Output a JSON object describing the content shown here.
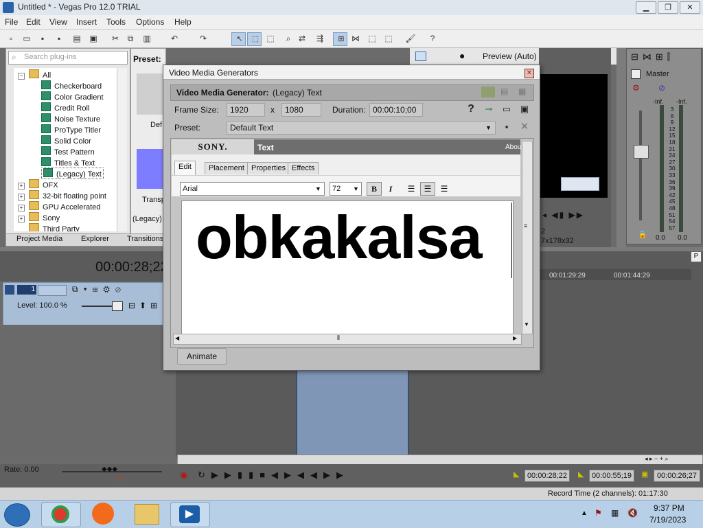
{
  "window": {
    "title": "Untitled * - Vegas Pro 12.0 TRIAL",
    "buttons": [
      "▁",
      "❐",
      "✕"
    ]
  },
  "menu": [
    "File",
    "Edit",
    "View",
    "Insert",
    "Tools",
    "Options",
    "Help"
  ],
  "plugins": {
    "search_placeholder": "Search plug-ins",
    "tree": [
      {
        "label": "All",
        "kind": "folder",
        "expander": "−"
      },
      {
        "label": "Checkerboard",
        "kind": "fx"
      },
      {
        "label": "Color Gradient",
        "kind": "fx"
      },
      {
        "label": "Credit Roll",
        "kind": "fx"
      },
      {
        "label": "Noise Texture",
        "kind": "fx"
      },
      {
        "label": "ProType Titler",
        "kind": "fx"
      },
      {
        "label": "Solid Color",
        "kind": "fx"
      },
      {
        "label": "Test Pattern",
        "kind": "fx"
      },
      {
        "label": "Titles & Text",
        "kind": "fx"
      },
      {
        "label": "(Legacy) Text",
        "kind": "fx",
        "selected": true
      },
      {
        "label": "OFX",
        "kind": "folder",
        "expander": "+"
      },
      {
        "label": "32-bit floating point",
        "kind": "folder",
        "expander": "+"
      },
      {
        "label": "GPU Accelerated",
        "kind": "folder",
        "expander": "+"
      },
      {
        "label": "Sony",
        "kind": "folder",
        "expander": "+"
      },
      {
        "label": "Third Party",
        "kind": "folder",
        "expander": ""
      }
    ],
    "preset_label": "Preset:",
    "preset_items": [
      "Def",
      "Transp",
      "(Legacy)"
    ]
  },
  "bottom_tabs": [
    "Project Media",
    "Explorer",
    "Transitions"
  ],
  "preview": {
    "label": "Preview (Auto)",
    "resolution": "7x178x32",
    "num": "2"
  },
  "master": {
    "title": "Master",
    "left_db": "-Inf.",
    "right_db": "-Inf.",
    "scale": [
      "3",
      "6",
      "9",
      "12",
      "15",
      "18",
      "21",
      "24",
      "27",
      "30",
      "33",
      "36",
      "39",
      "42",
      "45",
      "48",
      "51",
      "54",
      "57"
    ],
    "left_val": "0.0",
    "right_val": "0.0"
  },
  "timeline": {
    "timecode": "00:00:28;22",
    "track_number": "1",
    "level": "Level: 100.0 %",
    "ruler": [
      "00:01:29:29",
      "00:01:44:29"
    ],
    "rate": "Rate: 0.00",
    "time_a": "00:00:28;22",
    "time_b": "00:00:55;19",
    "time_c": "00:00:26;27",
    "record_time": "Record Time (2 channels): 01:17:30"
  },
  "dialog": {
    "title": "Video Media Generators",
    "generator_label": "Video Media Generator:",
    "generator_value": "(Legacy) Text",
    "frame_size_label": "Frame Size:",
    "width": "1920",
    "x_label": "x",
    "height": "1080",
    "duration_label": "Duration:",
    "duration": "00:00:10;00",
    "preset_label": "Preset:",
    "preset_value": "Default Text",
    "sony": "SONY.",
    "text_tab": "Text",
    "about": "About",
    "tabs": [
      "Edit",
      "Placement",
      "Properties",
      "Effects"
    ],
    "font": "Arial",
    "size": "72",
    "bold": "B",
    "italic": "I",
    "content": "obkakalsa",
    "animate": "Animate"
  },
  "clock": {
    "time": "9:37 PM",
    "date": "7/19/2023"
  },
  "colors": {
    "clip": "#7f96b6",
    "track": "#a8bdd6",
    "dialog": "#bdbdbd"
  }
}
